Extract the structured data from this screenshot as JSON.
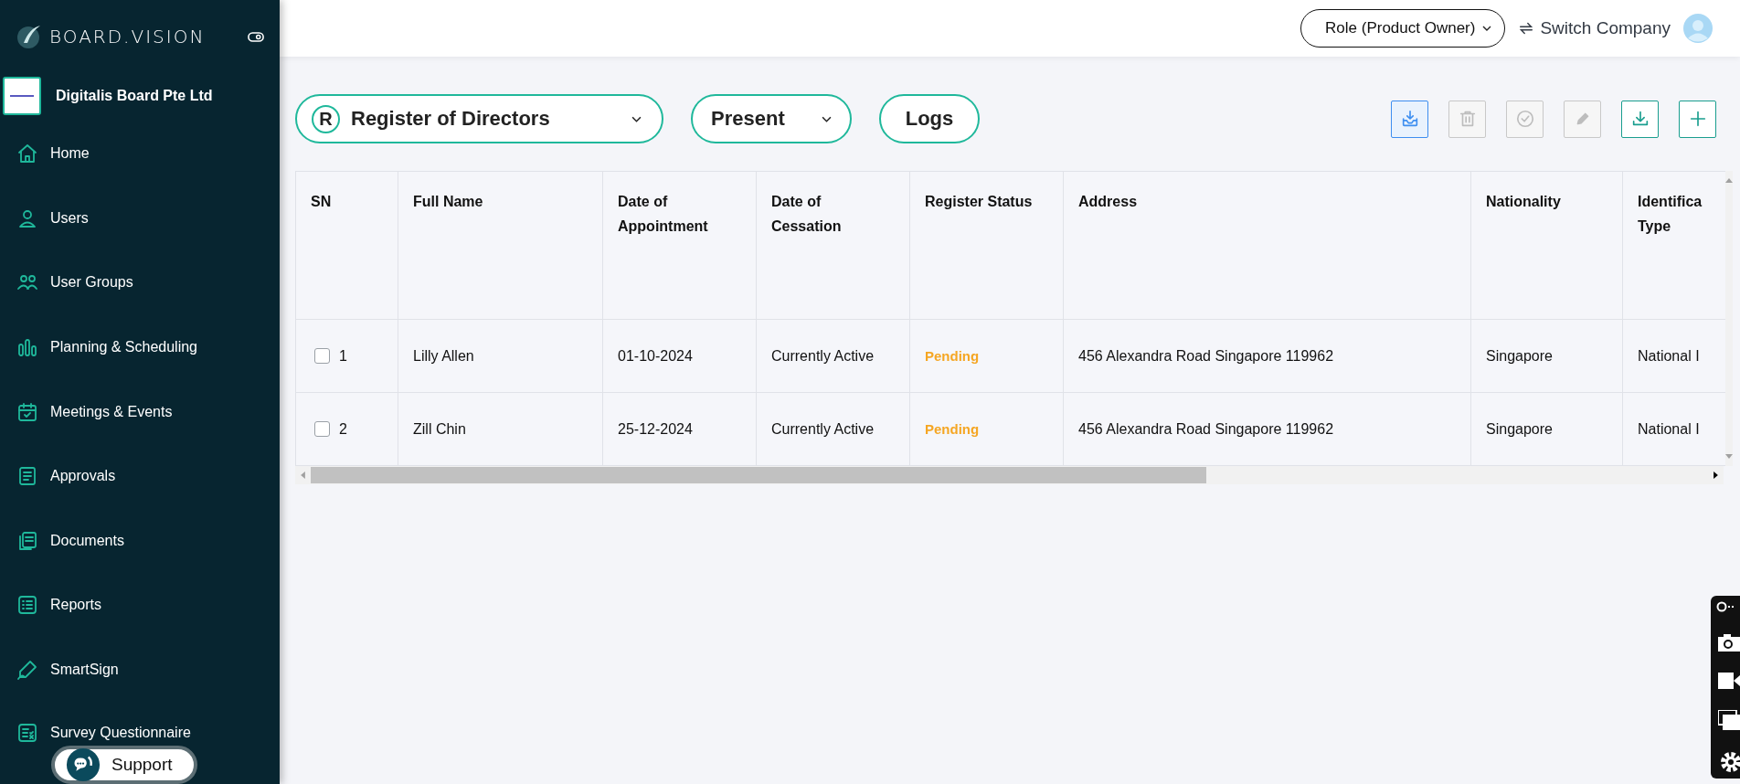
{
  "brand": {
    "name": "BOARD.VISION"
  },
  "company": {
    "name": "Digitalis Board Pte Ltd"
  },
  "sidebar": {
    "items": [
      {
        "label": "Home",
        "selected": false
      },
      {
        "label": "Users",
        "selected": false
      },
      {
        "label": "User Groups",
        "selected": false
      },
      {
        "label": "Planning & Scheduling",
        "selected": false
      },
      {
        "label": "Meetings & Events",
        "selected": false
      },
      {
        "label": "Approvals",
        "selected": false
      },
      {
        "label": "Documents",
        "selected": false
      },
      {
        "label": "Reports",
        "selected": false
      },
      {
        "label": "SmartSign",
        "selected": false
      },
      {
        "label": "Survey Questionnaire",
        "selected": false
      }
    ]
  },
  "support": {
    "label": "Support"
  },
  "header": {
    "role": "Role (Product Owner)",
    "switch": "Switch Company"
  },
  "filters": {
    "register": {
      "badge": "R",
      "label": "Register of Directors"
    },
    "period": "Present",
    "logs": "Logs"
  },
  "toolbar": [
    {
      "kind": "import",
      "disabled": false,
      "selected": true
    },
    {
      "kind": "delete",
      "disabled": true,
      "selected": false
    },
    {
      "kind": "approve",
      "disabled": true,
      "selected": false
    },
    {
      "kind": "edit",
      "disabled": true,
      "selected": false
    },
    {
      "kind": "download",
      "disabled": false,
      "selected": false
    },
    {
      "kind": "add",
      "disabled": false,
      "selected": false
    }
  ],
  "table": {
    "columns": [
      "SN",
      "Full Name",
      "Date of Appointment",
      "Date of Cessation",
      "Register Status",
      "Address",
      "Nationality",
      "Identifica Type"
    ],
    "rows": [
      {
        "checked": false,
        "sn": "1",
        "name": "Lilly Allen",
        "appointed": "01-10-2024",
        "ceased": "Currently Active",
        "status": {
          "text": "Pending",
          "color": "#f5a623"
        },
        "address": "456 Alexandra Road Singapore 119962",
        "nationality": "Singapore",
        "id_type": "National I"
      },
      {
        "checked": false,
        "sn": "2",
        "name": "Zill Chin",
        "appointed": "25-12-2024",
        "ceased": "Currently Active",
        "status": {
          "text": "Pending",
          "color": "#f5a623"
        },
        "address": "456 Alexandra Road Singapore 119962",
        "nationality": "Singapore",
        "id_type": "National I"
      }
    ]
  }
}
